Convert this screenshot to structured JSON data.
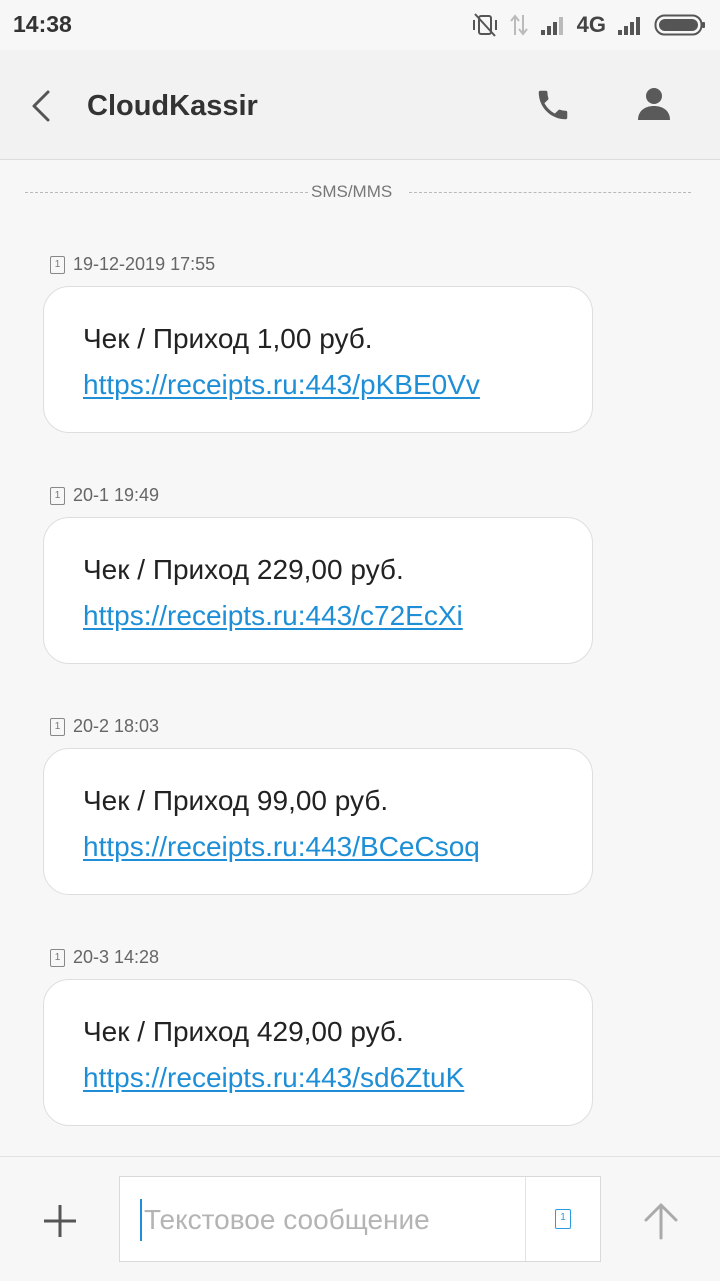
{
  "status": {
    "time": "14:38",
    "network": "4G",
    "icons": [
      "vibrate-off-icon",
      "data-arrows-icon",
      "signal-icon",
      "signal-icon",
      "battery-icon"
    ]
  },
  "header": {
    "title": "CloudKassir",
    "icons": [
      "back-arrow-icon",
      "phone-icon",
      "contact-icon"
    ]
  },
  "divider_label": "SMS/MMS",
  "sim_label": "1",
  "messages": [
    {
      "time": "19-12-2019 17:55",
      "text": "Чек / Приход 1,00 руб.",
      "link": "https://receipts.ru:443/pKBE0Vv"
    },
    {
      "time": "20-1 19:49",
      "text": "Чек / Приход 229,00 руб.",
      "link": "https://receipts.ru:443/c72EcXi"
    },
    {
      "time": "20-2 18:03",
      "text": "Чек / Приход 99,00 руб.",
      "link": "https://receipts.ru:443/BCeCsoq"
    },
    {
      "time": "20-3 14:28",
      "text": "Чек / Приход 429,00 руб.",
      "link": "https://receipts.ru:443/sd6ZtuK"
    }
  ],
  "compose": {
    "placeholder": "Текстовое сообщение",
    "icons": [
      "plus-icon",
      "sim-select-icon",
      "send-arrow-icon"
    ]
  },
  "colors": {
    "link": "#1e8fd6",
    "background": "#f7f7f7",
    "bubble": "#ffffff"
  }
}
